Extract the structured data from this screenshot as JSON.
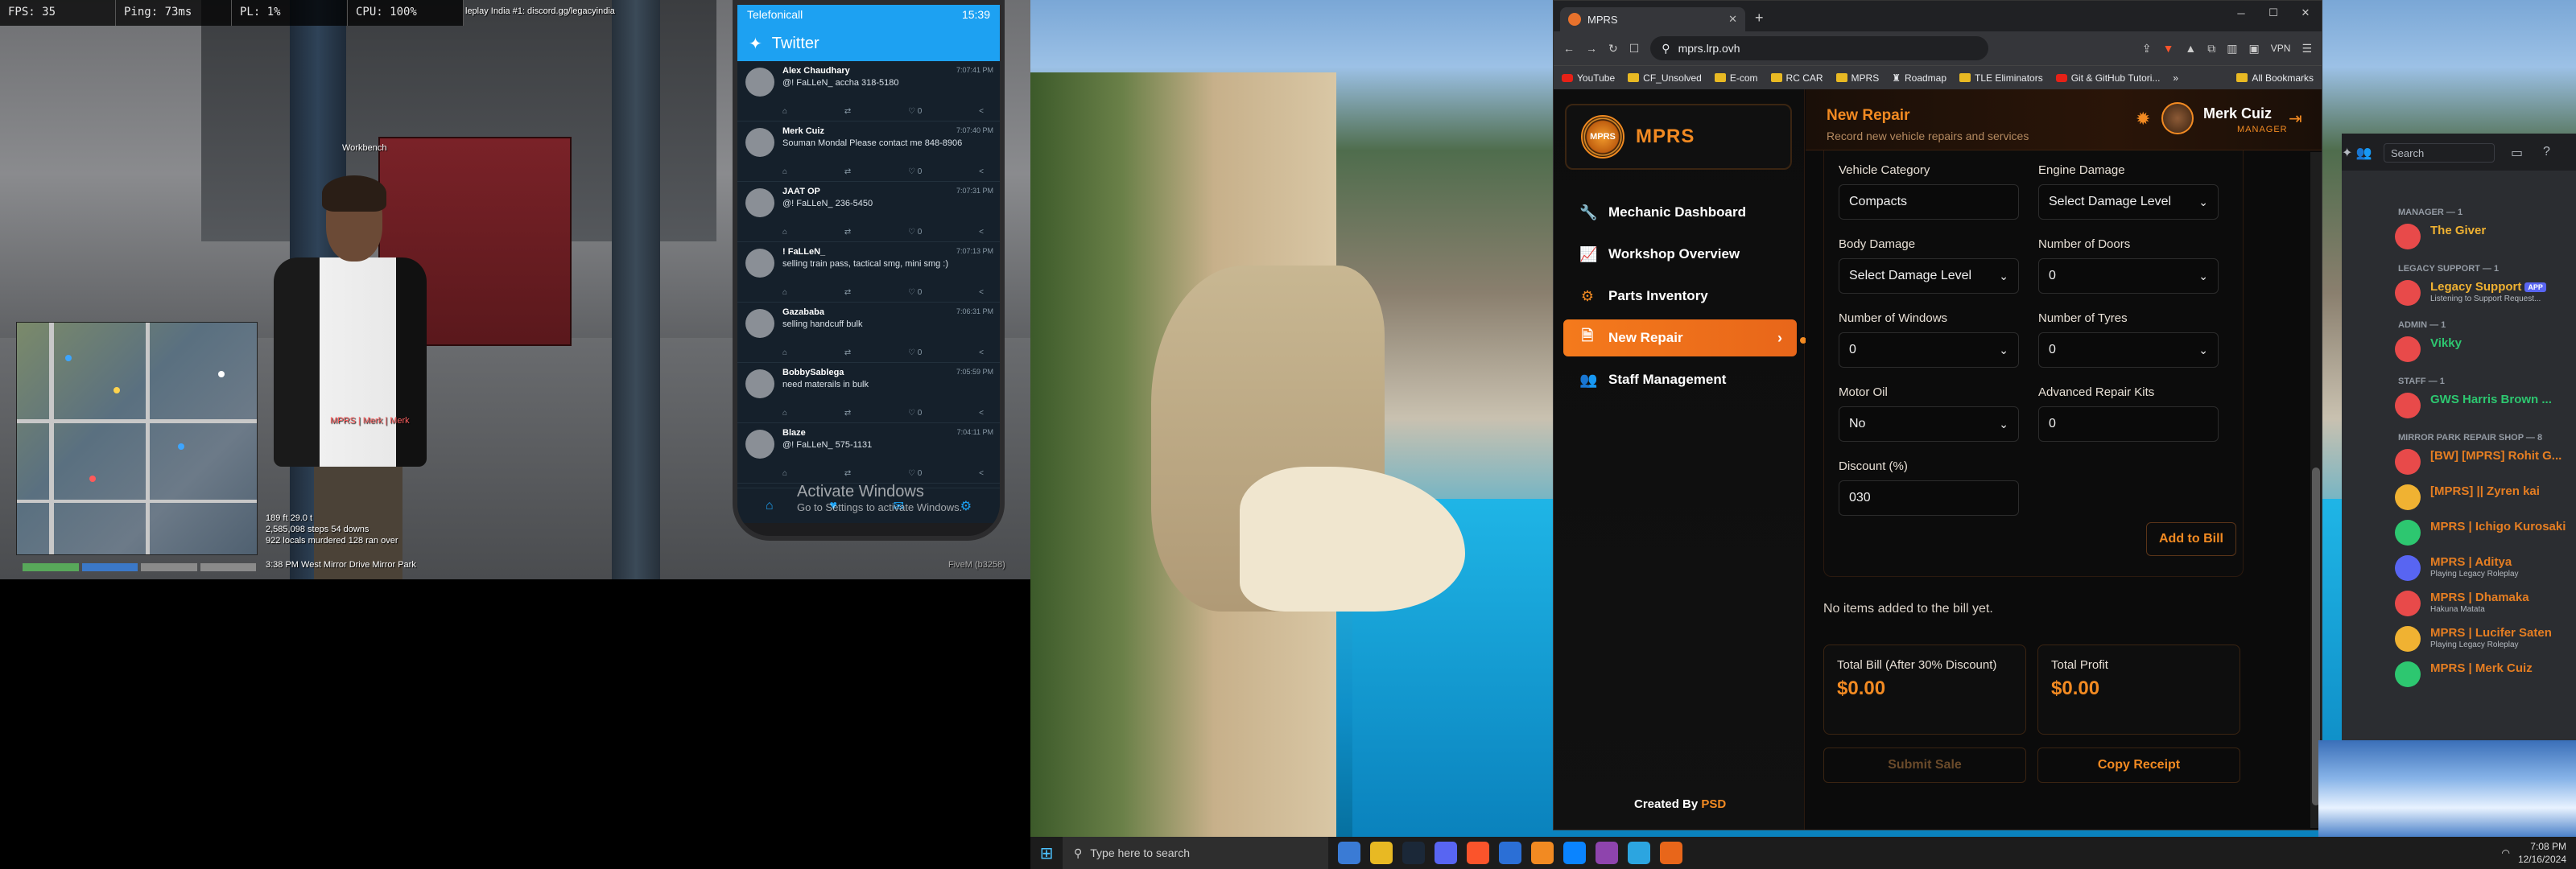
{
  "game": {
    "stats": {
      "fps": "FPS: 35",
      "ping": "Ping: 73ms",
      "pl": "PL: 1%",
      "cpu": "CPU: 100%"
    },
    "server_text": "leplay India #1: discord.gg/legacyindia",
    "worker_label": "Workbench",
    "player_label": "MPRS | Merk | Merk",
    "hud_lines": [
      "189 ft  29.0 t",
      "2,585,098 steps   54 downs",
      "922 locals murdered   128 ran over"
    ],
    "location": "3:38 PM   West Mirror Drive   Mirror Park",
    "fivem": "FiveM (b3258)"
  },
  "phone": {
    "carrier": "Telefonicall",
    "time": "15:39",
    "app_title": "Twitter",
    "tweets": [
      {
        "name": "Alex Chaudhary",
        "time": "7:07:41 PM",
        "text": "@! FaLLeN_ accha 318-5180"
      },
      {
        "name": "Merk Cuiz",
        "time": "7:07:40 PM",
        "text": "Souman Mondal Please contact me 848-8906"
      },
      {
        "name": "JAAT OP",
        "time": "7:07:31 PM",
        "text": "@! FaLLeN_ 236-5450"
      },
      {
        "name": "! FaLLeN_",
        "time": "7:07:13 PM",
        "text": "selling train pass, tactical smg, mini smg :)"
      },
      {
        "name": "Gazababa",
        "time": "7:06:31 PM",
        "text": "selling handcuff bulk"
      },
      {
        "name": "BobbySablega",
        "time": "7:05:59 PM",
        "text": "need materails in bulk"
      },
      {
        "name": "Blaze",
        "time": "7:04:11 PM",
        "text": "@! FaLLeN_ 575-1131"
      }
    ],
    "activate_title": "Activate Windows",
    "activate_sub": "Go to Settings to activate Windows."
  },
  "browser": {
    "tab_title": "MPRS",
    "url": "mprs.lrp.ovh",
    "vpn": "VPN",
    "bookmarks": [
      "YouTube",
      "CF_Unsolved",
      "E-com",
      "RC CAR",
      "MPRS",
      "Roadmap",
      "TLE Eliminators",
      "Git & GitHub Tutori..."
    ],
    "all_bookmarks": "All Bookmarks"
  },
  "app": {
    "brand": "MPRS",
    "emblem_text": "MPRS",
    "nav": [
      {
        "label": "Mechanic Dashboard",
        "icon": "wrench-icon",
        "glyph": "🔧"
      },
      {
        "label": "Workshop Overview",
        "icon": "chart-line-icon",
        "glyph": "📈"
      },
      {
        "label": "Parts Inventory",
        "icon": "cogs-icon",
        "glyph": "⚙"
      },
      {
        "label": "New Repair",
        "icon": "file-invoice-icon",
        "glyph": "🗎"
      },
      {
        "label": "Staff Management",
        "icon": "users-icon",
        "glyph": "👥"
      }
    ],
    "credit_prefix": "Created By ",
    "credit_name": "PSD",
    "header": {
      "title": "New Repair",
      "subtitle": "Record new vehicle repairs and services",
      "user": "Merk Cuiz",
      "role": "MANAGER"
    },
    "form": {
      "vehicle_category": {
        "label": "Vehicle Category",
        "value": "Compacts"
      },
      "engine_damage": {
        "label": "Engine Damage",
        "value": "Select Damage Level"
      },
      "body_damage": {
        "label": "Body Damage",
        "value": "Select Damage Level"
      },
      "doors": {
        "label": "Number of Doors",
        "value": "0"
      },
      "windows": {
        "label": "Number of Windows",
        "value": "0"
      },
      "tyres": {
        "label": "Number of Tyres",
        "value": "0"
      },
      "motor_oil": {
        "label": "Motor Oil",
        "value": "No"
      },
      "repair_kits": {
        "label": "Advanced Repair Kits",
        "value": "0"
      },
      "discount": {
        "label": "Discount (%)",
        "value": "030"
      },
      "add_to_bill": "Add to Bill"
    },
    "no_items": "No items added to the bill yet.",
    "total_bill": {
      "label": "Total Bill (After 30% Discount)",
      "value": "$0.00"
    },
    "total_profit": {
      "label": "Total Profit",
      "value": "$0.00"
    },
    "submit_sale": "Submit Sale",
    "copy_receipt": "Copy Receipt"
  },
  "discord": {
    "search_placeholder": "Search",
    "categories": [
      {
        "title": "MANAGER — 1",
        "members": [
          {
            "name": "The Giver",
            "color": "#f0b232",
            "status": ""
          }
        ]
      },
      {
        "title": "LEGACY SUPPORT — 1",
        "members": [
          {
            "name": "Legacy Support",
            "color": "#f0b232",
            "status": "Listening to Support Request...",
            "tag": "APP"
          }
        ]
      },
      {
        "title": "ADMIN — 1",
        "members": [
          {
            "name": "Vikky",
            "color": "#2dc770",
            "status": ""
          }
        ]
      },
      {
        "title": "STAFF — 1",
        "members": [
          {
            "name": "GWS Harris Brown ...",
            "color": "#2dc770",
            "status": ""
          }
        ]
      },
      {
        "title": "MIRROR PARK REPAIR SHOP — 8",
        "members": [
          {
            "name": "[BW] [MPRS] Rohit G...",
            "color": "#e67e22",
            "status": ""
          },
          {
            "name": "[MPRS] || Zyren kai",
            "color": "#e67e22",
            "status": ""
          },
          {
            "name": "MPRS | Ichigo Kurosaki",
            "color": "#e67e22",
            "status": ""
          },
          {
            "name": "MPRS | Aditya",
            "color": "#e67e22",
            "status": "Playing Legacy Roleplay"
          },
          {
            "name": "MPRS | Dhamaka",
            "color": "#e67e22",
            "status": "Hakuna Matata"
          },
          {
            "name": "MPRS | Lucifer Saten",
            "color": "#e67e22",
            "status": "Playing Legacy Roleplay"
          },
          {
            "name": "MPRS | Merk Cuiz",
            "color": "#e67e22",
            "status": ""
          }
        ]
      }
    ]
  },
  "taskbar": {
    "search": "Type here to search",
    "time": "7:08 PM",
    "date": "12/16/2024"
  }
}
